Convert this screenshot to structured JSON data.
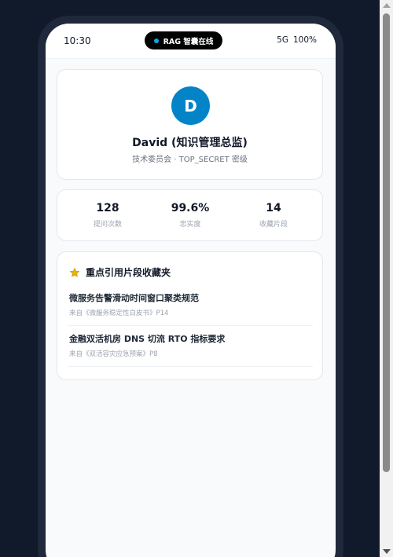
{
  "status_bar": {
    "time": "10:30",
    "pill_label": "RAG 智囊在线",
    "network": "5G",
    "battery": "100%"
  },
  "profile": {
    "avatar_initial": "D",
    "name": "David (知识管理总监)",
    "subtitle": "技术委员会 · TOP_SECRET 密级"
  },
  "stats": [
    {
      "value": "128",
      "label": "提问次数"
    },
    {
      "value": "99.6%",
      "label": "忠实度"
    },
    {
      "value": "14",
      "label": "收藏片段"
    }
  ],
  "favorites": {
    "title": "重点引用片段收藏夹",
    "icon": "star-icon",
    "items": [
      {
        "title": "微服务告警滑动时间窗口聚类规范",
        "source": "来自《微服务稳定性白皮书》P14"
      },
      {
        "title": "金融双活机房 DNS 切流 RTO 指标要求",
        "source": "来自《双活容灾应急预案》P8"
      }
    ]
  },
  "colors": {
    "background": "#111a2b",
    "accent": "#0284c7",
    "star": "#eab308"
  }
}
